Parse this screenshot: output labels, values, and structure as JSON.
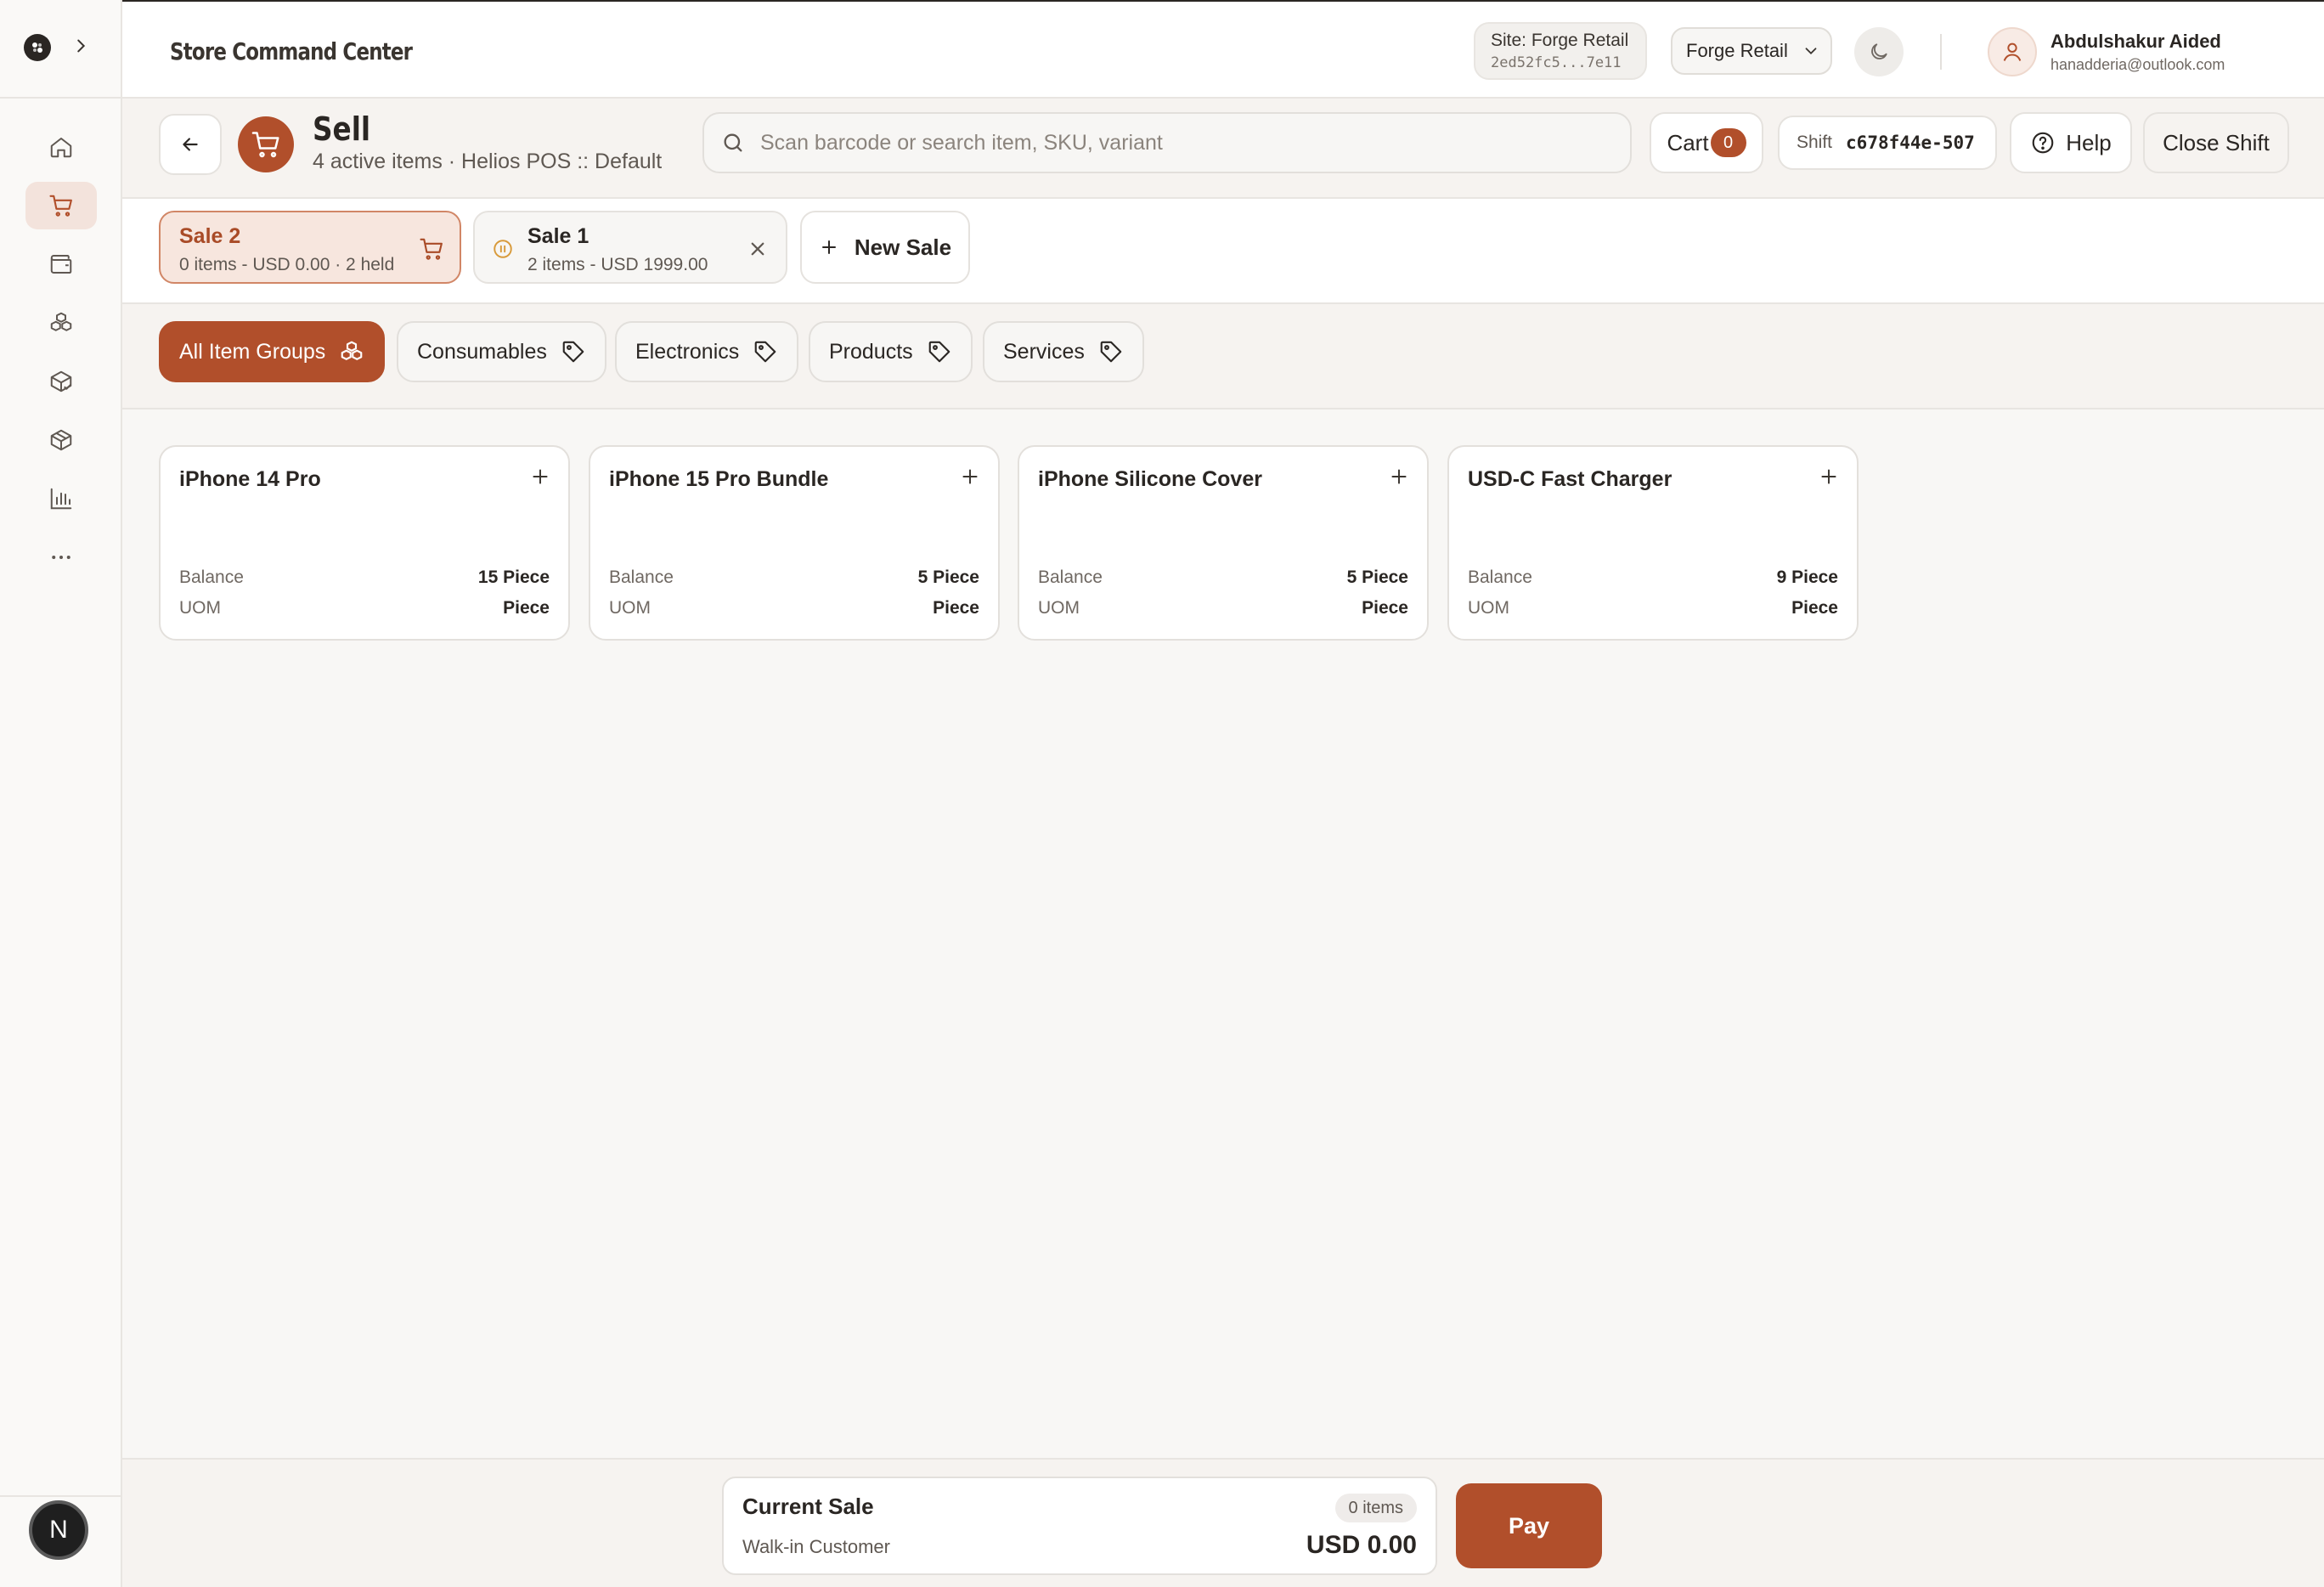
{
  "app": {
    "title": "Store Command Center"
  },
  "topbar": {
    "site_label": "Site: Forge Retail",
    "site_id": "2ed52fc5...7e11",
    "org_selected": "Forge Retail",
    "user_name": "Abdulshakur Aided",
    "user_email": "hanadderia@outlook.com"
  },
  "sidebar": {
    "items": [
      {
        "icon": "home-icon"
      },
      {
        "icon": "cart-icon",
        "active": true
      },
      {
        "icon": "wallet-icon"
      },
      {
        "icon": "boxes-icon"
      },
      {
        "icon": "package-check-icon"
      },
      {
        "icon": "package-icon"
      },
      {
        "icon": "bar-chart-icon"
      },
      {
        "icon": "more-icon"
      }
    ],
    "avatar_initial": "N"
  },
  "header": {
    "title": "Sell",
    "subtitle": "4 active items · Helios POS :: Default",
    "search_placeholder": "Scan barcode or search item, SKU, variant",
    "cart_label": "Cart",
    "cart_count": "0",
    "shift_label": "Shift",
    "shift_id": "c678f44e-507",
    "help_label": "Help",
    "close_shift_label": "Close Shift"
  },
  "sales": {
    "tabs": [
      {
        "title": "Sale 2",
        "summary": "0 items - USD 0.00 · 2 held",
        "active": true
      },
      {
        "title": "Sale 1",
        "summary": "2 items - USD 1999.00",
        "held": true
      }
    ],
    "new_sale_label": "New Sale"
  },
  "filters": {
    "chips": [
      {
        "label": "All Item Groups",
        "active": true
      },
      {
        "label": "Consumables"
      },
      {
        "label": "Electronics"
      },
      {
        "label": "Products"
      },
      {
        "label": "Services"
      }
    ]
  },
  "items": [
    {
      "name": "iPhone 14 Pro",
      "balance_label": "Balance",
      "balance": "15 Piece",
      "uom_label": "UOM",
      "uom": "Piece"
    },
    {
      "name": "iPhone 15 Pro Bundle",
      "balance_label": "Balance",
      "balance": "5 Piece",
      "uom_label": "UOM",
      "uom": "Piece"
    },
    {
      "name": "iPhone Silicone Cover",
      "balance_label": "Balance",
      "balance": "5 Piece",
      "uom_label": "UOM",
      "uom": "Piece"
    },
    {
      "name": "USD-C Fast Charger",
      "balance_label": "Balance",
      "balance": "9 Piece",
      "uom_label": "UOM",
      "uom": "Piece"
    }
  ],
  "current_sale": {
    "title": "Current Sale",
    "customer": "Walk-in Customer",
    "items_badge": "0 items",
    "total": "USD 0.00",
    "pay_label": "Pay"
  },
  "colors": {
    "accent": "#b14f2b",
    "accent_soft": "#f7e6de",
    "held": "#d89a3a"
  }
}
